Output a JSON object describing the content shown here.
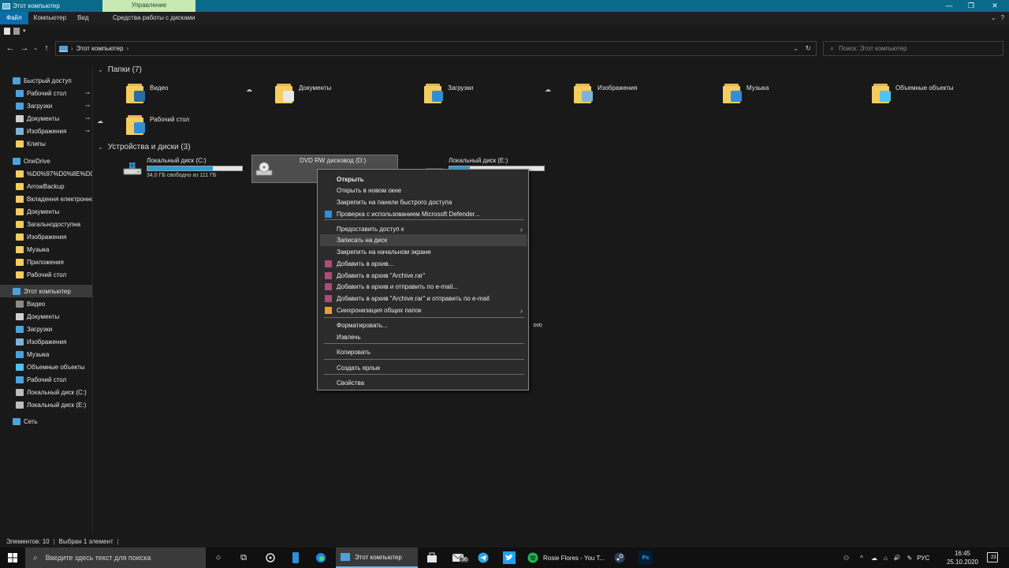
{
  "window": {
    "title": "Этот компьютер",
    "manage_tab": "Управление",
    "minimize": "—",
    "maximize": "❐",
    "close": "✕"
  },
  "ribbon": {
    "tabs": [
      "Файл",
      "Компьютер",
      "Вид"
    ],
    "drive_tools_tab": "Средства работы с дисками",
    "expand_symbol": "⌄",
    "help_symbol": "?"
  },
  "nav": {
    "back": "←",
    "forward": "→",
    "recent": "⌄",
    "up": "↑",
    "crumb_sep": "›",
    "location": "Этот компьютер",
    "crumb_end": "›",
    "dropdown": "⌄",
    "refresh": "↻",
    "search_placeholder": "Поиск: Этот компьютер"
  },
  "sidebar": {
    "items": [
      {
        "label": "Быстрый доступ",
        "icon": "star-icon",
        "color": "#4aa3df",
        "pinned": false
      },
      {
        "label": "Рабочий стол",
        "icon": "desktop-icon",
        "color": "#4aa3df",
        "pinned": true
      },
      {
        "label": "Загрузки",
        "icon": "downloads-icon",
        "color": "#4aa3df",
        "pinned": true
      },
      {
        "label": "Документы",
        "icon": "documents-icon",
        "color": "#cfcfcf",
        "pinned": true
      },
      {
        "label": "Изображения",
        "icon": "pictures-icon",
        "color": "#7fb2d9",
        "pinned": true
      },
      {
        "label": "Клипы",
        "icon": "folder-icon",
        "color": "#f4cd61",
        "pinned": false
      },
      {
        "label": "OneDrive",
        "icon": "onedrive-icon",
        "color": "#4aa3df",
        "pinned": false
      },
      {
        "label": "%D0%97%D0%8E%D0%9",
        "icon": "folder-icon",
        "color": "#f4cd61",
        "pinned": false
      },
      {
        "label": "ArrowBackup",
        "icon": "folder-icon",
        "color": "#f4cd61",
        "pinned": false
      },
      {
        "label": "Вкладення електронно",
        "icon": "folder-icon",
        "color": "#f4cd61",
        "pinned": false
      },
      {
        "label": "Документы",
        "icon": "folder-icon",
        "color": "#f4cd61",
        "pinned": false
      },
      {
        "label": "Загальнодоступна",
        "icon": "folder-icon",
        "color": "#f4cd61",
        "pinned": false
      },
      {
        "label": "Изображения",
        "icon": "folder-icon",
        "color": "#f4cd61",
        "pinned": false
      },
      {
        "label": "Музыка",
        "icon": "folder-icon",
        "color": "#f4cd61",
        "pinned": false
      },
      {
        "label": "Приложения",
        "icon": "folder-icon",
        "color": "#f4cd61",
        "pinned": false
      },
      {
        "label": "Рабочий стол",
        "icon": "folder-icon",
        "color": "#f4cd61",
        "pinned": false
      },
      {
        "label": "Этот компьютер",
        "icon": "computer-icon",
        "color": "#4aa3df",
        "pinned": false,
        "selected": true
      },
      {
        "label": "Видео",
        "icon": "video-icon",
        "color": "#8a8a8a",
        "pinned": false
      },
      {
        "label": "Документы",
        "icon": "documents-icon",
        "color": "#cfcfcf",
        "pinned": false
      },
      {
        "label": "Загрузки",
        "icon": "downloads-icon",
        "color": "#4aa3df",
        "pinned": false
      },
      {
        "label": "Изображения",
        "icon": "pictures-icon",
        "color": "#7fb2d9",
        "pinned": false
      },
      {
        "label": "Музыка",
        "icon": "music-icon",
        "color": "#4aa3df",
        "pinned": false
      },
      {
        "label": "Объемные объекты",
        "icon": "3d-objects-icon",
        "color": "#4fc3f7",
        "pinned": false
      },
      {
        "label": "Рабочий стол",
        "icon": "desktop-icon",
        "color": "#4aa3df",
        "pinned": false
      },
      {
        "label": "Локальный диск (C:)",
        "icon": "drive-icon",
        "color": "#bdbdbd",
        "pinned": false
      },
      {
        "label": "Локальный диск (E:)",
        "icon": "drive-icon",
        "color": "#bdbdbd",
        "pinned": false
      },
      {
        "label": "Сеть",
        "icon": "network-icon",
        "color": "#4aa3df",
        "pinned": false
      }
    ],
    "pin_symbol": "📌"
  },
  "folders_section": {
    "title": "Папки (7)",
    "chevron": "⌄",
    "items": [
      {
        "label": "Видео",
        "icon": "video-folder-icon",
        "badge_color": "#2d6aa8",
        "cloud": false
      },
      {
        "label": "Документы",
        "icon": "documents-folder-icon",
        "badge_color": "#e8e8e8",
        "cloud": true
      },
      {
        "label": "Загрузки",
        "icon": "downloads-folder-icon",
        "badge_color": "#2f8fd8",
        "cloud": false
      },
      {
        "label": "Изображения",
        "icon": "pictures-folder-icon",
        "badge_color": "#7fb2d9",
        "cloud": true
      },
      {
        "label": "Музыка",
        "icon": "music-folder-icon",
        "badge_color": "#2f8fd8",
        "cloud": false
      },
      {
        "label": "Объемные объекты",
        "icon": "3d-objects-folder-icon",
        "badge_color": "#4fc3f7",
        "cloud": false
      },
      {
        "label": "Рабочий стол",
        "icon": "desktop-folder-icon",
        "badge_color": "#2f8fd8",
        "cloud": true
      }
    ],
    "cloud_symbol": "☁"
  },
  "devices_section": {
    "title": "Устройства и диски (3)",
    "chevron": "⌄",
    "drives": [
      {
        "label": "Локальный диск (C:)",
        "free_text": "34,0 ГБ свободно из 111 ГБ",
        "used_fraction": 0.69,
        "icon": "windows-drive-icon"
      },
      {
        "label": "DVD RW дисковод (D:)",
        "icon": "dvd-drive-icon",
        "icon_text": "DVD",
        "selected": true
      },
      {
        "label": "Локальный диск (E:)",
        "used_fraction": 0.22,
        "icon": "drive-icon"
      }
    ]
  },
  "context_menu": {
    "items": [
      {
        "label": "Открыть",
        "bold": true
      },
      {
        "label": "Открыть в новом окне"
      },
      {
        "label": "Закрепить на панели быстрого доступа"
      },
      {
        "label": "Проверка с использованием Microsoft Defender...",
        "icon": "defender-icon",
        "color": "#2f8fd8"
      },
      {
        "label": "Предоставить доступ к",
        "submenu": true
      },
      {
        "label": "Записать на диск",
        "highlighted": true
      },
      {
        "label": "Закрепить на начальном экране"
      },
      {
        "label": "Добавить в архив...",
        "icon": "winrar-icon",
        "color": "#b04a7a"
      },
      {
        "label": "Добавить в архив \"Archive.rar\"",
        "icon": "winrar-icon",
        "color": "#b04a7a"
      },
      {
        "label": "Добавить в архив и отправить по e-mail...",
        "icon": "winrar-icon",
        "color": "#b04a7a"
      },
      {
        "label": "Добавить в архив \"Archive.rar\" и отправить по e-mail",
        "icon": "winrar-icon",
        "color": "#b04a7a"
      },
      {
        "label": "Синхронизация общих папок",
        "icon": "sync-icon",
        "color": "#e8a030",
        "submenu": true
      },
      {
        "label": "Форматировать..."
      },
      {
        "label": "Извлечь"
      },
      {
        "label": "Копировать"
      },
      {
        "label": "Создать ярлык"
      },
      {
        "label": "Свойства"
      }
    ],
    "submenu_arrow": "›"
  },
  "statusbar": {
    "items_count": "Элементов: 10",
    "selected": "Выбран 1 элемент",
    "sep": "|"
  },
  "taskbar": {
    "search_placeholder": "Введите здесь текст для поиска",
    "explorer_label": "Этот компьютер",
    "spotify_label": "Rosie Flores - You T...",
    "mail_badge": "36",
    "lang": "РУС",
    "time": "16:45",
    "date": "25.10.2020",
    "notif_count": "23",
    "start_symbol": "⊞",
    "search_symbol": "⌕",
    "cortana_symbol": "○",
    "taskview_symbol": "⧉",
    "tray_people": "⚇",
    "tray_chevron": "^",
    "tray_cloud": "☁",
    "tray_network": "⌂",
    "tray_volume": "🔊",
    "tray_pen": "✎",
    "photoshop_text": "Ps"
  },
  "colors": {
    "accent": "#0b6cab",
    "titlebar": "#0a6a8a",
    "manage_tab": "#c7e8b3",
    "background": "#191919",
    "progress": "#26a0da"
  }
}
